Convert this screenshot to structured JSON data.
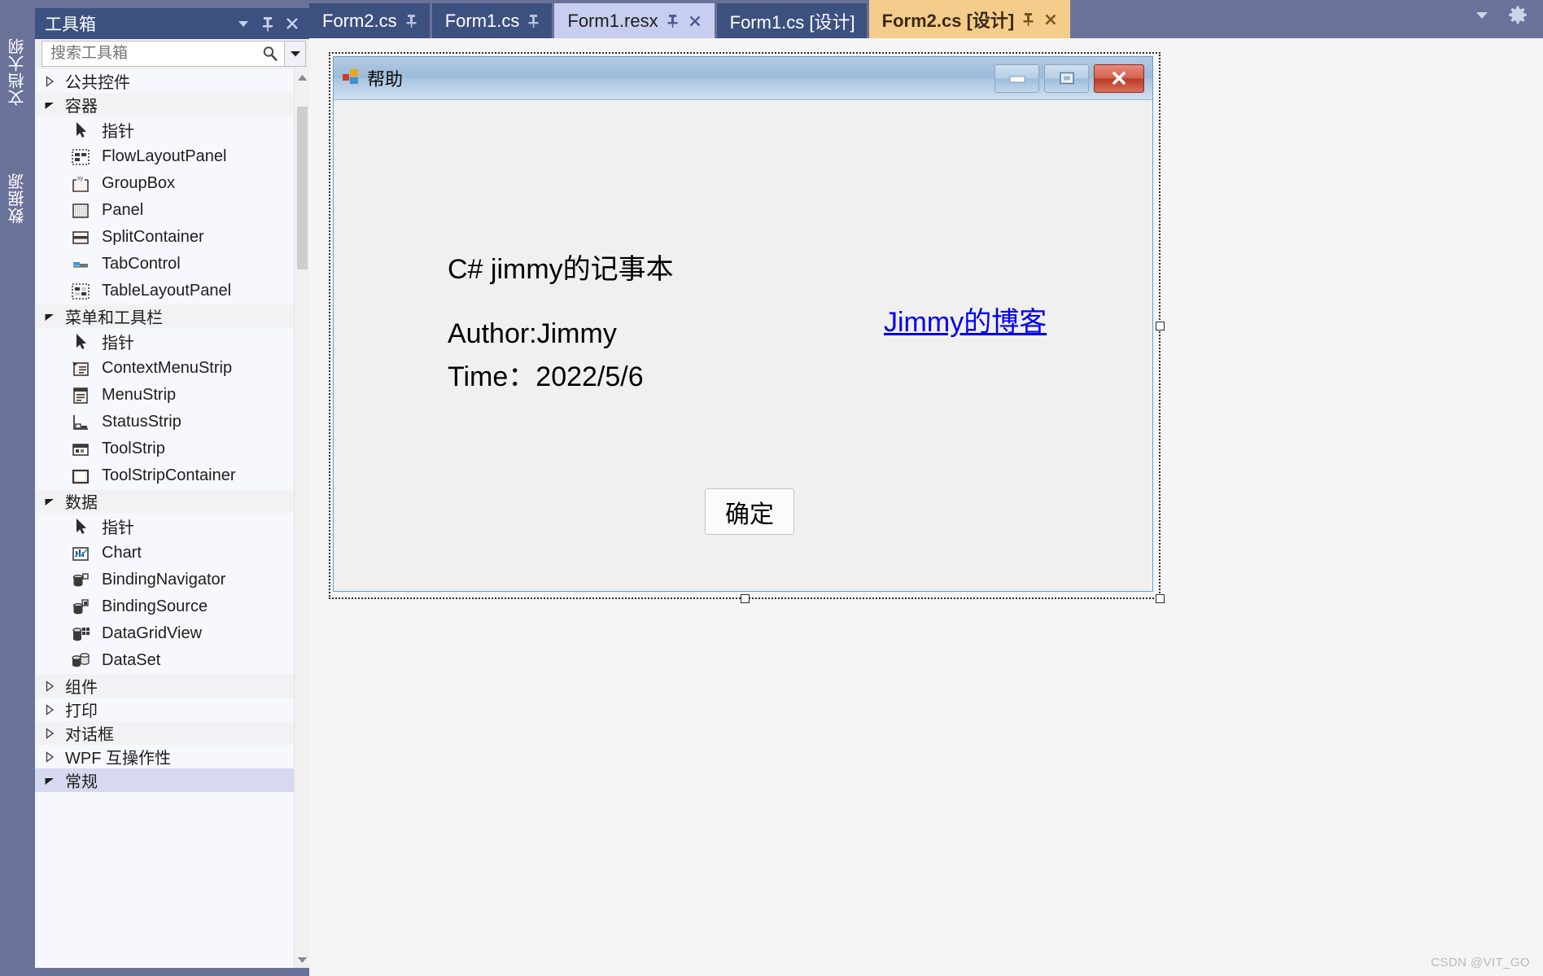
{
  "vertical_tabs": [
    {
      "label": "文档大纲",
      "name": "document-outline"
    },
    {
      "label": "数据源",
      "name": "data-sources"
    }
  ],
  "toolbox": {
    "title": "工具箱",
    "title_buttons": [
      {
        "name": "chevron-down-icon",
        "label": "▼"
      },
      {
        "name": "pin-icon",
        "label": "⚲"
      },
      {
        "name": "close-icon",
        "label": "✕"
      }
    ],
    "search": {
      "placeholder": "搜索工具箱",
      "value": "",
      "icon": "search-icon",
      "dropdown_icon": "chevron-down-icon"
    },
    "tree": [
      {
        "type": "category",
        "label": "公共控件",
        "expanded": false,
        "state": "normal"
      },
      {
        "type": "category",
        "label": "容器",
        "expanded": true,
        "state": "shaded"
      },
      {
        "type": "item",
        "label": "指针",
        "icon": "pointer-icon"
      },
      {
        "type": "item",
        "label": "FlowLayoutPanel",
        "icon": "flowlayoutpanel-icon"
      },
      {
        "type": "item",
        "label": "GroupBox",
        "icon": "groupbox-icon"
      },
      {
        "type": "item",
        "label": "Panel",
        "icon": "panel-icon"
      },
      {
        "type": "item",
        "label": "SplitContainer",
        "icon": "splitcontainer-icon"
      },
      {
        "type": "item",
        "label": "TabControl",
        "icon": "tabcontrol-icon"
      },
      {
        "type": "item",
        "label": "TableLayoutPanel",
        "icon": "tablelayoutpanel-icon"
      },
      {
        "type": "category",
        "label": "菜单和工具栏",
        "expanded": true,
        "state": "shaded"
      },
      {
        "type": "item",
        "label": "指针",
        "icon": "pointer-icon"
      },
      {
        "type": "item",
        "label": "ContextMenuStrip",
        "icon": "contextmenustrip-icon"
      },
      {
        "type": "item",
        "label": "MenuStrip",
        "icon": "menustrip-icon"
      },
      {
        "type": "item",
        "label": "StatusStrip",
        "icon": "statusstrip-icon"
      },
      {
        "type": "item",
        "label": "ToolStrip",
        "icon": "toolstrip-icon"
      },
      {
        "type": "item",
        "label": "ToolStripContainer",
        "icon": "toolstripcontainer-icon"
      },
      {
        "type": "category",
        "label": "数据",
        "expanded": true,
        "state": "shaded"
      },
      {
        "type": "item",
        "label": "指针",
        "icon": "pointer-icon"
      },
      {
        "type": "item",
        "label": "Chart",
        "icon": "chart-icon"
      },
      {
        "type": "item",
        "label": "BindingNavigator",
        "icon": "bindingnavigator-icon"
      },
      {
        "type": "item",
        "label": "BindingSource",
        "icon": "bindingsource-icon"
      },
      {
        "type": "item",
        "label": "DataGridView",
        "icon": "datagridview-icon"
      },
      {
        "type": "item",
        "label": "DataSet",
        "icon": "dataset-icon"
      },
      {
        "type": "category",
        "label": "组件",
        "expanded": false,
        "state": "shaded"
      },
      {
        "type": "category",
        "label": "打印",
        "expanded": false,
        "state": "normal"
      },
      {
        "type": "category",
        "label": "对话框",
        "expanded": false,
        "state": "shaded"
      },
      {
        "type": "category",
        "label": "WPF 互操作性",
        "expanded": false,
        "state": "normal"
      },
      {
        "type": "category",
        "label": "常规",
        "expanded": true,
        "state": "selected"
      }
    ]
  },
  "editor_tabs": [
    {
      "label": "Form2.cs",
      "state": "inactive",
      "pin": true,
      "close": false
    },
    {
      "label": "Form1.cs",
      "state": "inactive",
      "pin": true,
      "close": false
    },
    {
      "label": "Form1.resx",
      "state": "preview",
      "pin": true,
      "close": true
    },
    {
      "label": "Form1.cs [设计]",
      "state": "inactive",
      "pin": false,
      "close": false
    },
    {
      "label": "Form2.cs [设计]",
      "state": "active",
      "pin": true,
      "close": true
    }
  ],
  "tabstrip_right": [
    {
      "name": "chevron-down-icon",
      "label": "▼"
    },
    {
      "name": "gear-icon",
      "label": "⚙"
    }
  ],
  "form": {
    "title": "帮助",
    "icon": "vs-project-icon",
    "window_buttons": [
      {
        "name": "minimize-button"
      },
      {
        "name": "maximize-button"
      },
      {
        "name": "close-button"
      }
    ],
    "labels": {
      "title": "C# jimmy的记事本",
      "author": "Author:Jimmy",
      "time": "Time：2022/5/6"
    },
    "link": "Jimmy的博客",
    "ok_button": "确定"
  },
  "watermark": "CSDN @VIT_GO",
  "colors": {
    "shell": "#6b7299",
    "tab_inactive": "#3d5180",
    "tab_preview": "#c7cef0",
    "tab_active": "#f4cd8c",
    "link": "#0000ee",
    "close_button": "#ba3a26"
  }
}
